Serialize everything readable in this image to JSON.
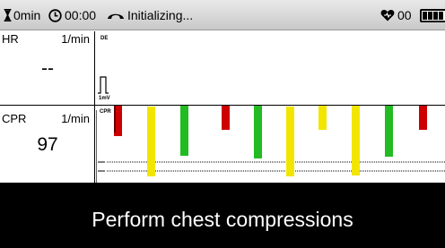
{
  "status": {
    "elapsed_icon": "hourglass-icon",
    "elapsed": "0min",
    "clock_icon": "clock-icon",
    "clock": "00:00",
    "connection_icon": "handset-icon",
    "connection_status": "Initializing...",
    "heart_icon": "heart-icon",
    "heart_count": "00",
    "battery_icon": "battery-icon"
  },
  "hr_panel": {
    "name": "HR",
    "unit": "1/min",
    "value": "--",
    "wave_tag": "DE",
    "calibration_label": "1mV"
  },
  "cpr_panel": {
    "name": "CPR",
    "unit": "1/min",
    "value": "97",
    "wave_tag": "CPR"
  },
  "cpr_markers": [
    {
      "color": "#cc0000"
    },
    {
      "color": "#f2e600"
    },
    {
      "color": "#22bb22"
    },
    {
      "color": "#cc0000"
    },
    {
      "color": "#22bb22"
    },
    {
      "color": "#f2e600"
    },
    {
      "color": "#f2e600"
    },
    {
      "color": "#f2e600"
    },
    {
      "color": "#22bb22"
    },
    {
      "color": "#cc0000"
    }
  ],
  "message": "Perform chest compressions"
}
